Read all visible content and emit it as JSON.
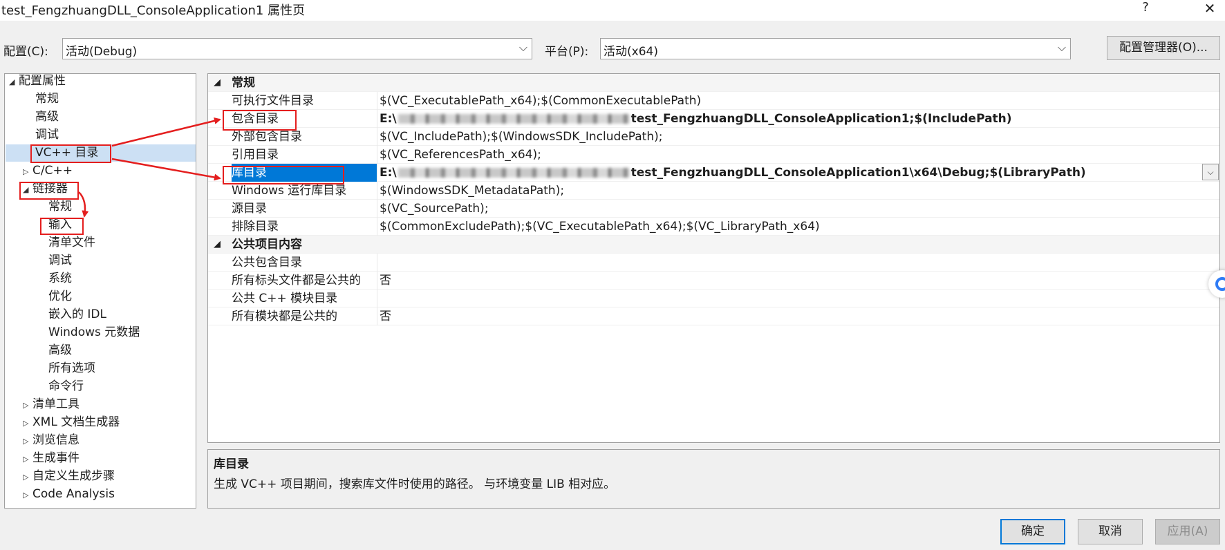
{
  "window": {
    "title": "test_FengzhuangDLL_ConsoleApplication1 属性页",
    "help_glyph": "?",
    "close_glyph": "✕"
  },
  "config": {
    "config_label": "配置(C):",
    "config_value": "活动(Debug)",
    "platform_label": "平台(P):",
    "platform_value": "活动(x64)",
    "manager_button": "配置管理器(O)..."
  },
  "tree": {
    "items": [
      {
        "label": "配置属性",
        "expander": "◢"
      },
      {
        "label": "常规",
        "expander": ""
      },
      {
        "label": "高级",
        "expander": ""
      },
      {
        "label": "调试",
        "expander": ""
      },
      {
        "label": "VC++ 目录",
        "expander": ""
      },
      {
        "label": "C/C++",
        "expander": "▷"
      },
      {
        "label": "链接器",
        "expander": "◢"
      },
      {
        "label": "常规",
        "expander": ""
      },
      {
        "label": "输入",
        "expander": ""
      },
      {
        "label": "清单文件",
        "expander": ""
      },
      {
        "label": "调试",
        "expander": ""
      },
      {
        "label": "系统",
        "expander": ""
      },
      {
        "label": "优化",
        "expander": ""
      },
      {
        "label": "嵌入的 IDL",
        "expander": ""
      },
      {
        "label": "Windows 元数据",
        "expander": ""
      },
      {
        "label": "高级",
        "expander": ""
      },
      {
        "label": "所有选项",
        "expander": ""
      },
      {
        "label": "命令行",
        "expander": ""
      },
      {
        "label": "清单工具",
        "expander": "▷"
      },
      {
        "label": "XML 文档生成器",
        "expander": "▷"
      },
      {
        "label": "浏览信息",
        "expander": "▷"
      },
      {
        "label": "生成事件",
        "expander": "▷"
      },
      {
        "label": "自定义生成步骤",
        "expander": "▷"
      },
      {
        "label": "Code Analysis",
        "expander": "▷"
      }
    ]
  },
  "grid": {
    "cat_general": "常规",
    "cat_public": "公共项目内容",
    "cat_expander": "◢",
    "rows": [
      {
        "name": "可执行文件目录",
        "value": "$(VC_ExecutablePath_x64);$(CommonExecutablePath)"
      },
      {
        "name": "包含目录",
        "prefix": "E:\\",
        "value": "test_FengzhuangDLL_ConsoleApplication1;$(IncludePath)"
      },
      {
        "name": "外部包含目录",
        "value": "$(VC_IncludePath);$(WindowsSDK_IncludePath);"
      },
      {
        "name": "引用目录",
        "value": "$(VC_ReferencesPath_x64);"
      },
      {
        "name": "库目录",
        "prefix": "E:\\",
        "value": "test_FengzhuangDLL_ConsoleApplication1\\x64\\Debug;$(LibraryPath)"
      },
      {
        "name": "Windows 运行库目录",
        "value": "$(WindowsSDK_MetadataPath);"
      },
      {
        "name": "源目录",
        "value": "$(VC_SourcePath);"
      },
      {
        "name": "排除目录",
        "value": "$(CommonExcludePath);$(VC_ExecutablePath_x64);$(VC_LibraryPath_x64)"
      }
    ],
    "public_rows": [
      {
        "name": "公共包含目录",
        "value": ""
      },
      {
        "name": "所有标头文件都是公共的",
        "value": "否"
      },
      {
        "name": "公共 C++ 模块目录",
        "value": ""
      },
      {
        "name": "所有模块都是公共的",
        "value": "否"
      }
    ]
  },
  "description": {
    "title": "库目录",
    "text": "生成 VC++ 项目期间，搜索库文件时使用的路径。 与环境变量 LIB 相对应。"
  },
  "buttons": {
    "ok": "确定",
    "cancel": "取消",
    "apply": "应用(A)"
  },
  "colors": {
    "annotation_red": "#e41e1e",
    "selection_blue": "#0078d7"
  }
}
